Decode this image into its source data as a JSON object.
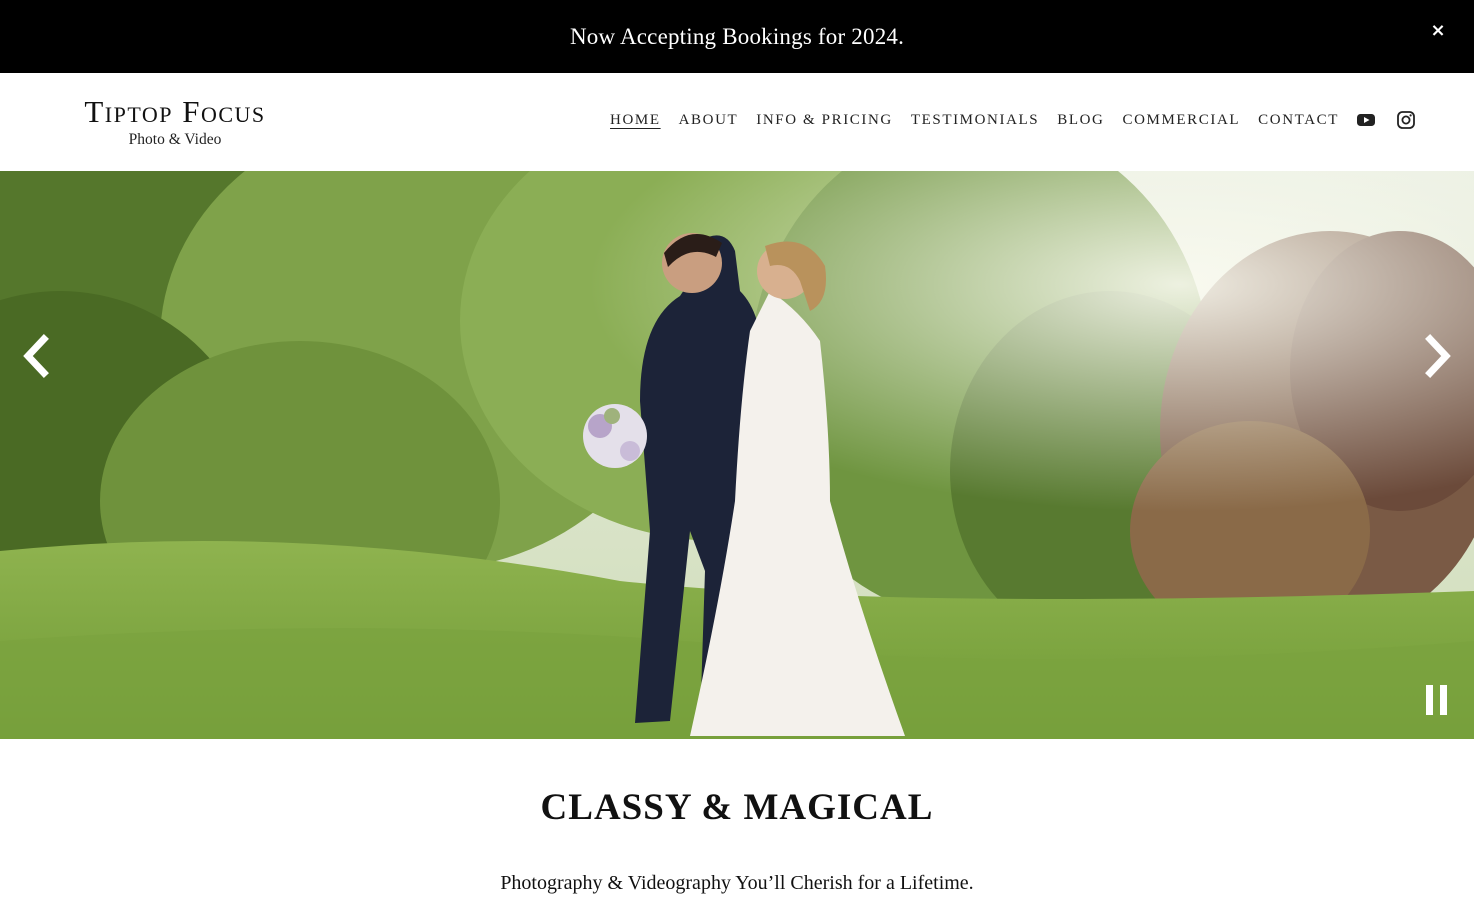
{
  "announcement": {
    "text": "Now Accepting Bookings for 2024.",
    "close_icon": "×"
  },
  "header": {
    "brand_title": "Tiptop Focus",
    "brand_subtitle": "Photo & Video",
    "nav": [
      {
        "label": "HOME",
        "active": true
      },
      {
        "label": "ABOUT"
      },
      {
        "label": "INFO & PRICING"
      },
      {
        "label": "TESTIMONIALS"
      },
      {
        "label": "BLOG"
      },
      {
        "label": "COMMERCIAL"
      },
      {
        "label": "CONTACT"
      }
    ],
    "social": [
      "youtube-icon",
      "instagram-icon"
    ]
  },
  "hero": {
    "controls": [
      "chevron-left-icon",
      "chevron-right-icon",
      "pause-icon"
    ]
  },
  "intro": {
    "headline": "CLASSY & MAGICAL",
    "tagline": "Photography & Videography You’ll Cherish for a Lifetime."
  },
  "colors": {
    "announcement_bg": "#000000",
    "text": "#111111",
    "background": "#ffffff"
  }
}
